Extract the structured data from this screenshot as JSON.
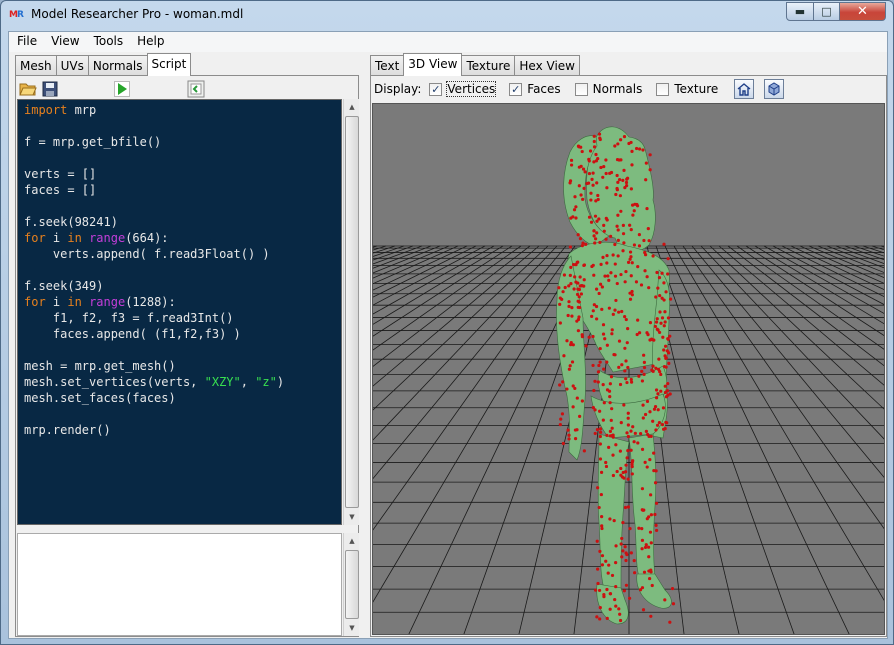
{
  "window": {
    "title": "Model Researcher Pro - woman.mdl",
    "icon_letters_m": "M",
    "icon_letters_r": "R",
    "min_glyph": "▬",
    "max_glyph": "□",
    "close_glyph": "✕"
  },
  "menu": [
    "File",
    "View",
    "Tools",
    "Help"
  ],
  "left_tabs": [
    "Mesh",
    "UVs",
    "Normals",
    "Script"
  ],
  "left_active_tab": "Script",
  "toolbar": {
    "icons": [
      "open-folder-icon",
      "save-icon",
      "run-icon",
      "clear-icon"
    ]
  },
  "script_lines": [
    [
      [
        "kw",
        "import"
      ],
      [
        "t",
        " mrp"
      ]
    ],
    [],
    [
      [
        "t",
        "f = mrp.get_bfile()"
      ]
    ],
    [],
    [
      [
        "t",
        "verts = []"
      ]
    ],
    [
      [
        "t",
        "faces = []"
      ]
    ],
    [],
    [
      [
        "t",
        "f.seek(98241)"
      ]
    ],
    [
      [
        "kw",
        "for"
      ],
      [
        "t",
        " i "
      ],
      [
        "kw",
        "in"
      ],
      [
        "t",
        " "
      ],
      [
        "fn",
        "range"
      ],
      [
        "t",
        "(664):"
      ]
    ],
    [
      [
        "t",
        "    verts.append( f.read3Float() )"
      ]
    ],
    [],
    [
      [
        "t",
        "f.seek(349)"
      ]
    ],
    [
      [
        "kw",
        "for"
      ],
      [
        "t",
        " i "
      ],
      [
        "kw",
        "in"
      ],
      [
        "t",
        " "
      ],
      [
        "fn",
        "range"
      ],
      [
        "t",
        "(1288):"
      ]
    ],
    [
      [
        "t",
        "    f1, f2, f3 = f.read3Int()"
      ]
    ],
    [
      [
        "t",
        "    faces.append( (f1,f2,f3) )"
      ]
    ],
    [],
    [
      [
        "t",
        "mesh = mrp.get_mesh()"
      ]
    ],
    [
      [
        "t",
        "mesh.set_vertices(verts, "
      ],
      [
        "str",
        "\"XZY\""
      ],
      [
        "t",
        ", "
      ],
      [
        "str",
        "\"z\""
      ],
      [
        "t",
        ")"
      ]
    ],
    [
      [
        "t",
        "mesh.set_faces(faces)"
      ]
    ],
    [],
    [
      [
        "t",
        "mrp.render()"
      ]
    ]
  ],
  "right_tabs": [
    "Text",
    "3D View",
    "Texture",
    "Hex View"
  ],
  "right_active_tab": "3D View",
  "display": {
    "label": "Display:",
    "options": [
      {
        "label": "Vertices",
        "checked": true
      },
      {
        "label": "Faces",
        "checked": true
      },
      {
        "label": "Normals",
        "checked": false
      },
      {
        "label": "Texture",
        "checked": false
      }
    ],
    "check_glyph": "✓",
    "buttons": [
      "home-view-icon",
      "cube-view-icon"
    ]
  },
  "viewport": {
    "background": "#7a7a7a",
    "grid_color": "#1a1a1a",
    "model_color": "#7dbb7f",
    "vertex_color": "#cc1111"
  }
}
